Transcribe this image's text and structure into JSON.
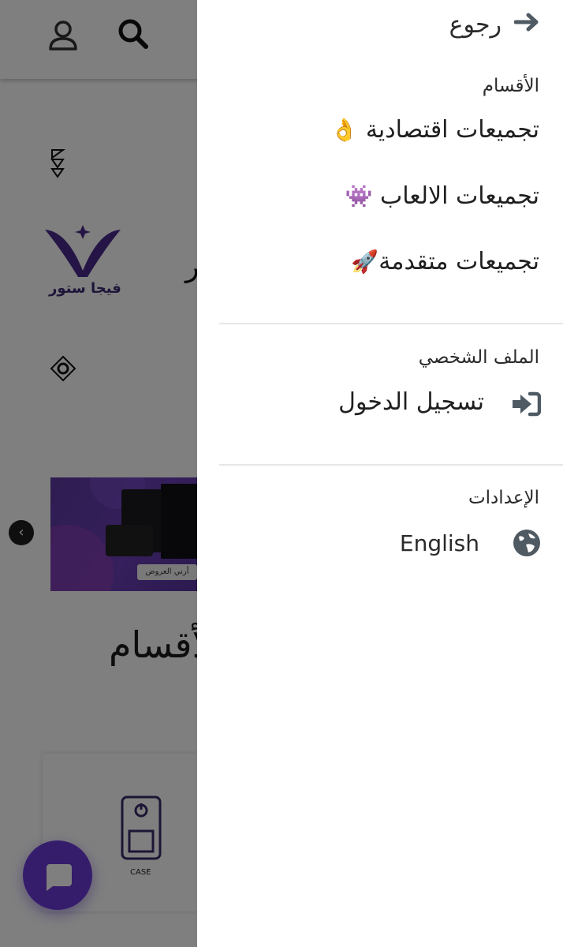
{
  "background": {
    "banner_button": "أرني العروض",
    "section_title": "الأقسام",
    "partial_char": "ر",
    "logo_text": "فيجا ستور",
    "card_label": "CASE"
  },
  "drawer": {
    "back_label": "رجوع",
    "categories": {
      "heading": "الأقسام",
      "items": [
        {
          "label": "تجميعات اقتصادية",
          "emoji": "👌"
        },
        {
          "label": "تجميعات الالعاب",
          "emoji": "👾"
        },
        {
          "label": "تجميعات متقدمة",
          "emoji": "🚀"
        }
      ]
    },
    "profile": {
      "heading": "الملف الشخصي",
      "login_label": "تسجيل الدخول"
    },
    "settings": {
      "heading": "الإعدادات",
      "language_label": "English"
    }
  },
  "colors": {
    "accent": "#6a3bd9",
    "icon": "#4f5a63",
    "overlay": "rgba(0,0,0,0.5)"
  }
}
